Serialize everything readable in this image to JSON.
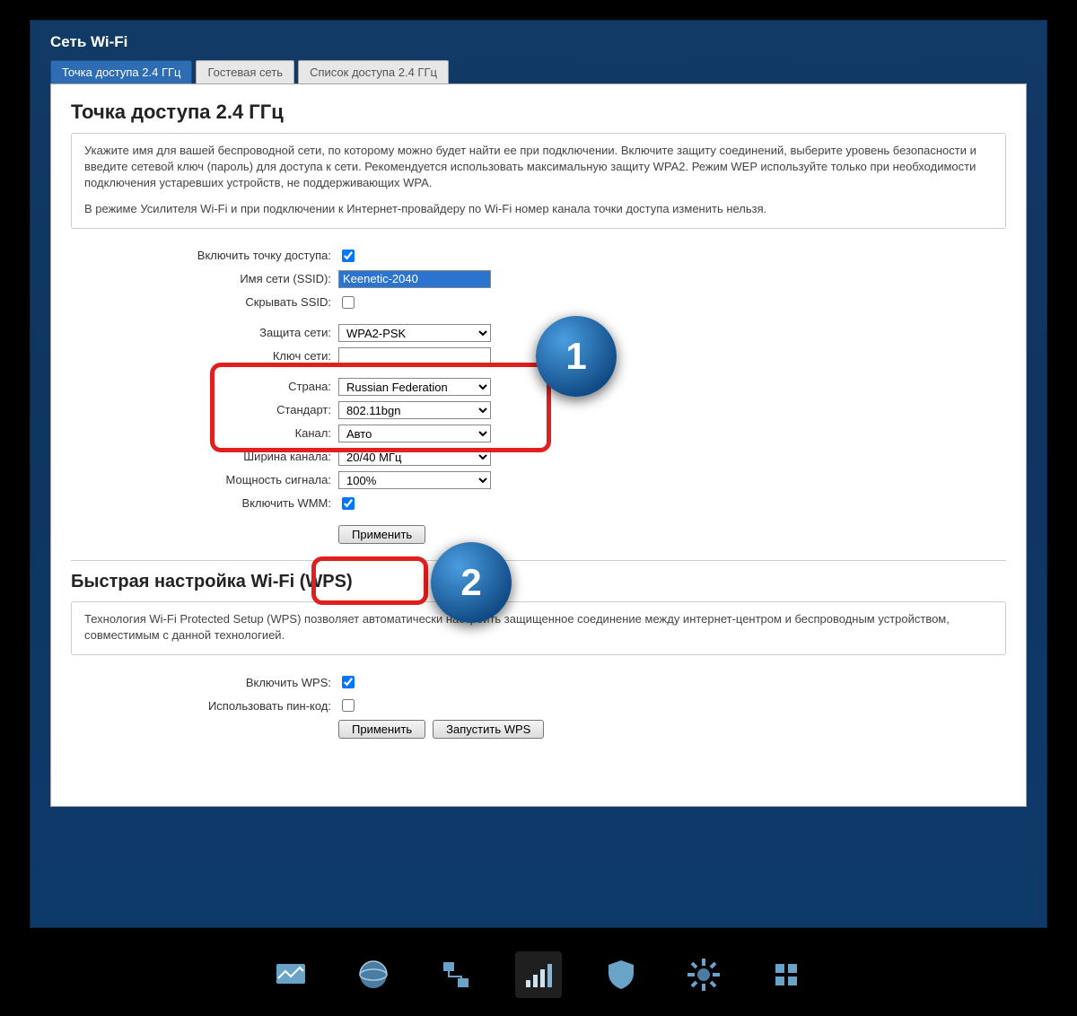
{
  "header": {
    "title": "Сеть Wi-Fi"
  },
  "tabs": [
    {
      "label": "Точка доступа 2.4 ГГц",
      "active": true
    },
    {
      "label": "Гостевая сеть",
      "active": false
    },
    {
      "label": "Список доступа 2.4 ГГц",
      "active": false
    }
  ],
  "section_ap": {
    "title": "Точка доступа 2.4 ГГц",
    "desc1": "Укажите имя для вашей беспроводной сети, по которому можно будет найти ее при подключении. Включите защиту соединений, выберите уровень безопасности и введите сетевой ключ (пароль) для доступа к сети. Рекомендуется использовать максимальную защиту WPA2. Режим WEP используйте только при необходимости подключения устаревших устройств, не поддерживающих WPA.",
    "desc2": "В режиме Усилителя Wi-Fi и при подключении к Интернет-провайдеру по Wi-Fi номер канала точки доступа изменить нельзя.",
    "labels": {
      "enable_ap": "Включить точку доступа:",
      "ssid": "Имя сети (SSID):",
      "hide_ssid": "Скрывать SSID:",
      "security": "Защита сети:",
      "key": "Ключ сети:",
      "country": "Страна:",
      "standard": "Стандарт:",
      "channel": "Канал:",
      "width": "Ширина канала:",
      "power": "Мощность сигнала:",
      "wmm": "Включить WMM:"
    },
    "values": {
      "enable_ap": true,
      "ssid": "Keenetic-2040",
      "hide_ssid": false,
      "security": "WPA2-PSK",
      "key": "",
      "country": "Russian Federation",
      "standard": "802.11bgn",
      "channel": "Авто",
      "width": "20/40 МГц",
      "power": "100%",
      "wmm": true
    },
    "apply": "Применить"
  },
  "section_wps": {
    "title": "Быстрая настройка Wi-Fi (WPS)",
    "desc": "Технология Wi-Fi Protected Setup (WPS) позволяет автоматически настроить защищенное соединение между интернет-центром и беспроводным устройством, совместимым с данной технологией.",
    "labels": {
      "enable_wps": "Включить WPS:",
      "use_pin": "Использовать пин-код:"
    },
    "values": {
      "enable_wps": true,
      "use_pin": false
    },
    "apply": "Применить",
    "start": "Запустить WPS"
  },
  "annotations": {
    "b1": "1",
    "b2": "2"
  },
  "nav_icons": [
    "monitor-icon",
    "globe-icon",
    "network-icon",
    "wifi-icon",
    "shield-icon",
    "gear-icon",
    "apps-icon"
  ]
}
